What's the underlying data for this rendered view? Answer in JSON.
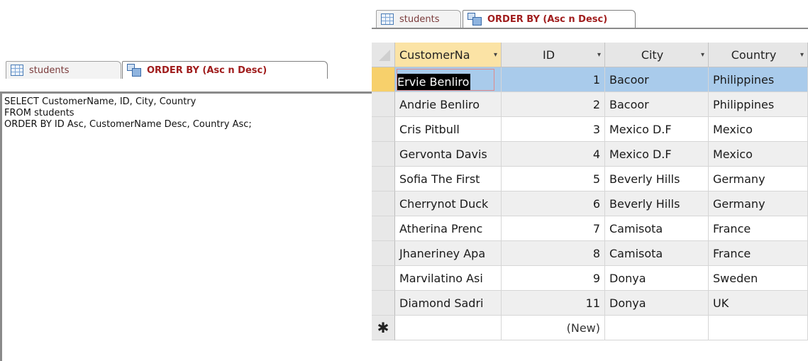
{
  "left_pane": {
    "tabs": [
      {
        "label": "students",
        "icon": "table-icon"
      },
      {
        "label": "ORDER BY (Asc n Desc)",
        "icon": "query-icon"
      }
    ],
    "sql": "SELECT CustomerName, ID, City, Country\nFROM students\nORDER BY ID Asc, CustomerName Desc, Country Asc;"
  },
  "right_pane": {
    "tabs": [
      {
        "label": "students",
        "icon": "table-icon"
      },
      {
        "label": "ORDER BY (Asc n Desc)",
        "icon": "query-icon"
      }
    ],
    "columns": [
      "CustomerNa",
      "ID",
      "City",
      "Country"
    ],
    "rows": [
      {
        "name": "Ervie Benliro",
        "id": "1",
        "city": "Bacoor",
        "country": "Philippines"
      },
      {
        "name": "Andrie Benliro",
        "id": "2",
        "city": "Bacoor",
        "country": "Philippines"
      },
      {
        "name": "Cris Pitbull",
        "id": "3",
        "city": "Mexico D.F",
        "country": "Mexico"
      },
      {
        "name": "Gervonta Davis",
        "id": "4",
        "city": "Mexico D.F",
        "country": "Mexico"
      },
      {
        "name": "Sofia The First",
        "id": "5",
        "city": "Beverly Hills",
        "country": "Germany"
      },
      {
        "name": "Cherrynot Duck",
        "id": "6",
        "city": "Beverly Hills",
        "country": "Germany"
      },
      {
        "name": "Atherina Prenc",
        "id": "7",
        "city": "Camisota",
        "country": "France"
      },
      {
        "name": "Jhaneriney Apa",
        "id": "8",
        "city": "Camisota",
        "country": "France"
      },
      {
        "name": "Marvilatino Asi",
        "id": "9",
        "city": "Donya",
        "country": "Sweden"
      },
      {
        "name": "Diamond Sadri",
        "id": "11",
        "city": "Donya",
        "country": "UK"
      }
    ],
    "new_row": {
      "marker": "✱",
      "id_placeholder": "(New)"
    }
  }
}
